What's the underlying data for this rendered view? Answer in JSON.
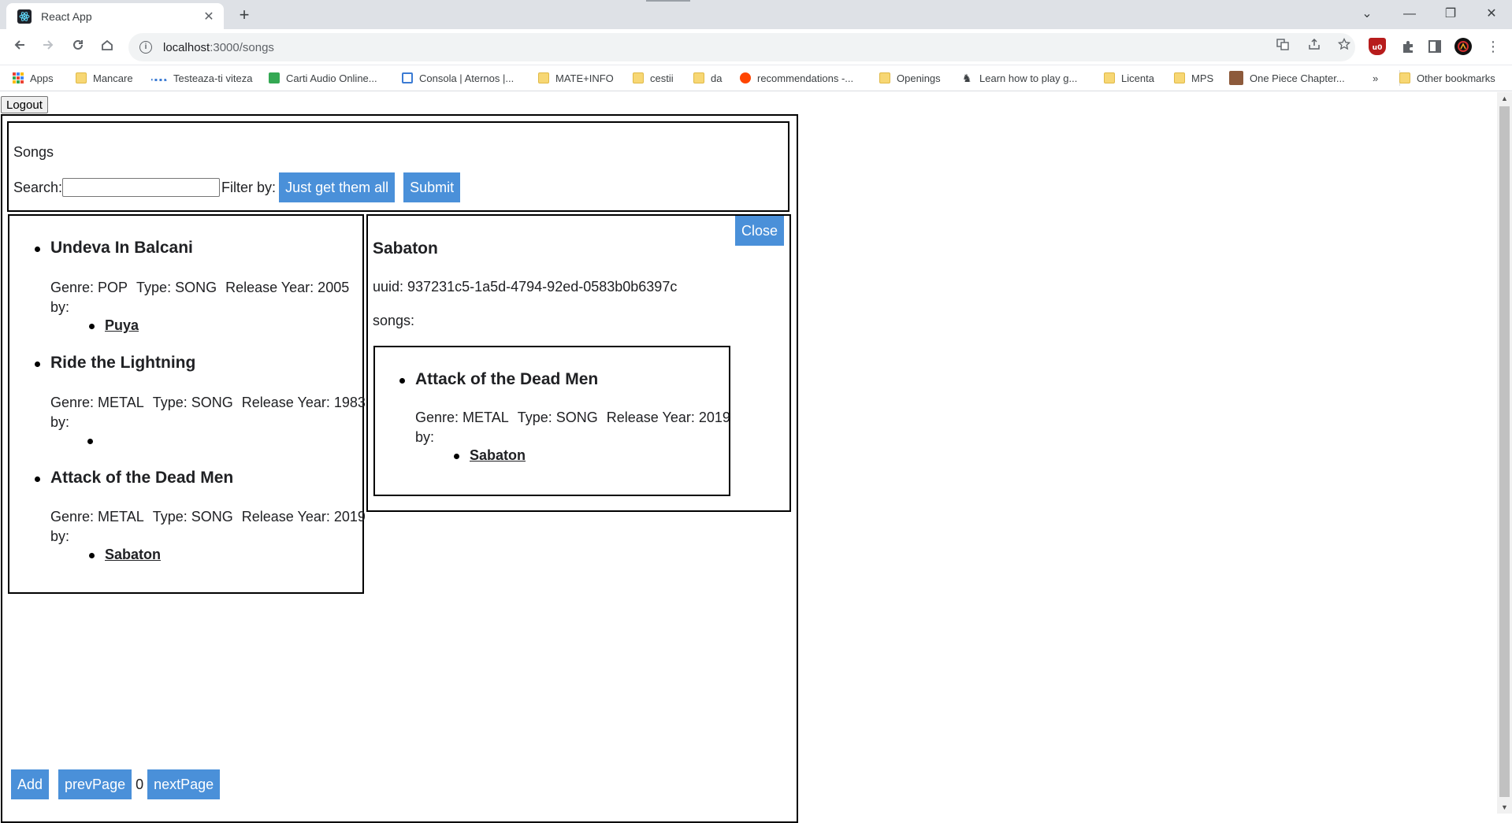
{
  "browser": {
    "tab_title": "React App",
    "tab_close": "✕",
    "new_tab": "+",
    "url_host": "localhost",
    "url_path": ":3000/songs",
    "window_controls": [
      "⌄",
      "—",
      "❐",
      "✕"
    ]
  },
  "bookmarks": [
    {
      "label": "Apps",
      "icon": "apps-grid-icon"
    },
    {
      "label": "Mancare",
      "icon": "folder-icon"
    },
    {
      "label": "Testeaza-ti viteza",
      "icon": "speedtest-icon"
    },
    {
      "label": "Carti Audio Online...",
      "icon": "green-square-icon"
    },
    {
      "label": "Consola | Aternos |...",
      "icon": "aternos-icon"
    },
    {
      "label": "MATE+INFO",
      "icon": "folder-icon"
    },
    {
      "label": "cestii",
      "icon": "folder-icon"
    },
    {
      "label": "da",
      "icon": "folder-icon"
    },
    {
      "label": "recommendations -...",
      "icon": "reddit-icon"
    },
    {
      "label": "Openings",
      "icon": "folder-icon"
    },
    {
      "label": "Learn how to play g...",
      "icon": "chess-icon"
    },
    {
      "label": "Licenta",
      "icon": "folder-icon"
    },
    {
      "label": "MPS",
      "icon": "folder-icon"
    },
    {
      "label": "One Piece Chapter...",
      "icon": "manga-icon"
    }
  ],
  "bookmarks_overflow": "»",
  "other_bookmarks": "Other bookmarks",
  "app": {
    "logout_label": "Logout",
    "header_title": "Songs",
    "search_label": "Search:",
    "search_value": "",
    "filter_label": "Filter by:",
    "filter_button": "Just get them all",
    "submit_button": "Submit",
    "songs": [
      {
        "title": "Undeva In Balcani",
        "genre": "Genre: POP",
        "type": "Type: SONG",
        "year": "Release Year: 2005",
        "by": "by:",
        "artists": [
          "Puya"
        ]
      },
      {
        "title": "Ride the Lightning",
        "genre": "Genre: METAL",
        "type": "Type: SONG",
        "year": "Release Year: 1983",
        "by": "by:",
        "artists": [
          ""
        ]
      },
      {
        "title": "Attack of the Dead Men",
        "genre": "Genre: METAL",
        "type": "Type: SONG",
        "year": "Release Year: 2019",
        "by": "by:",
        "artists": [
          "Sabaton"
        ]
      }
    ],
    "detail": {
      "close_button": "Close",
      "name": "Sabaton",
      "uuid": "uuid: 937231c5-1a5d-4794-92ed-0583b0b6397c",
      "songs_label": "songs:",
      "songs": [
        {
          "title": "Attack of the Dead Men",
          "genre": "Genre: METAL",
          "type": "Type: SONG",
          "year": "Release Year: 2019",
          "by": "by:",
          "artists": [
            "Sabaton"
          ]
        }
      ]
    },
    "add_button": "Add",
    "prev_button": "prevPage",
    "page_number": "0",
    "next_button": "nextPage"
  },
  "colors": {
    "button_blue": "#4a90d9",
    "tab_strip": "#dee1e6",
    "omnibox": "#f1f3f4"
  }
}
